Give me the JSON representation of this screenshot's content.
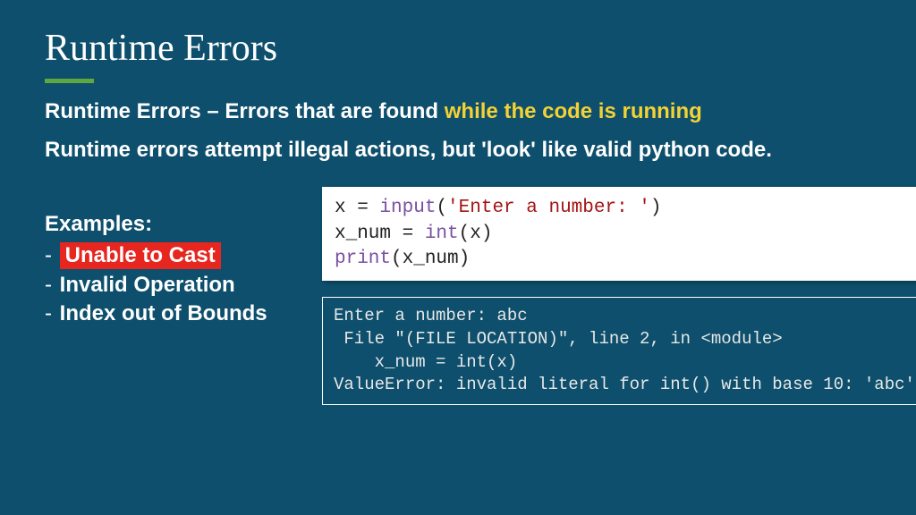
{
  "title": "Runtime Errors",
  "definition": {
    "prefix": "Runtime Errors – Errors that are found ",
    "emphasis": "while the code is running"
  },
  "subtext": "Runtime errors attempt illegal actions, but 'look' like valid python code.",
  "examples": {
    "heading": "Examples:",
    "items": [
      {
        "text": "Unable to Cast",
        "highlighted": true
      },
      {
        "text": "Invalid Operation",
        "highlighted": false
      },
      {
        "text": "Index out of Bounds",
        "highlighted": false
      }
    ]
  },
  "code": {
    "l1a": "x = ",
    "l1b": "input",
    "l1c": "(",
    "l1d": "'Enter a number: '",
    "l1e": ")",
    "l2a": "x_num = ",
    "l2b": "int",
    "l2c": "(x)",
    "l3a": "print",
    "l3b": "(x_num)"
  },
  "output": "Enter a number: abc\n File \"(FILE LOCATION)\", line 2, in <module>\n    x_num = int(x)\nValueError: invalid literal for int() with base 10: 'abc'"
}
